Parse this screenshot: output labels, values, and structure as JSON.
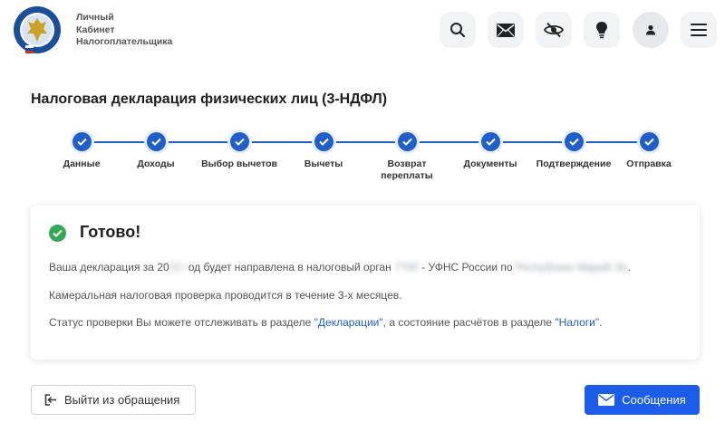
{
  "header": {
    "brand_lines": [
      "Личный",
      "Кабинет",
      "Налогоплательщика"
    ],
    "icons": [
      "search-icon",
      "mail-icon",
      "eye-off-icon",
      "lightbulb-icon",
      "user-icon",
      "menu-icon"
    ]
  },
  "page": {
    "title": "Налоговая декларация физических лиц (3-НДФЛ)"
  },
  "steps": [
    {
      "label": "Данные",
      "done": true
    },
    {
      "label": "Доходы",
      "done": true
    },
    {
      "label": "Выбор вычетов",
      "done": true
    },
    {
      "label": "Вычеты",
      "done": true
    },
    {
      "label": "Возврат переплаты",
      "done": true
    },
    {
      "label": "Документы",
      "done": true
    },
    {
      "label": "Подтверждение",
      "done": true
    },
    {
      "label": "Отправка",
      "done": true
    }
  ],
  "result": {
    "title": "Готово!",
    "line1_a": "Ваша декларация за 20",
    "line1_year_hidden": "22 г",
    "line1_b": "од будет направлена в налоговый орган",
    "line1_code_hidden": "7700",
    "line1_c": " - УФНС России по ",
    "line1_region_hidden": "Республике Марий Эл",
    "line1_d": ".",
    "line2": "Камеральная налоговая проверка проводится в течение 3-х месяцев.",
    "line3_a": "Статус проверки Вы можете отслеживать в разделе ",
    "line3_link1": "\"Декларации\"",
    "line3_b": ", а состояние расчётов в разделе ",
    "line3_link2": "\"Налоги\"",
    "line3_c": "."
  },
  "buttons": {
    "exit_label": "Выйти из обращения",
    "messages_label": "Сообщения"
  },
  "colors": {
    "primary": "#1f5fc7",
    "button_primary": "#1c5ce8",
    "success": "#34a853"
  }
}
